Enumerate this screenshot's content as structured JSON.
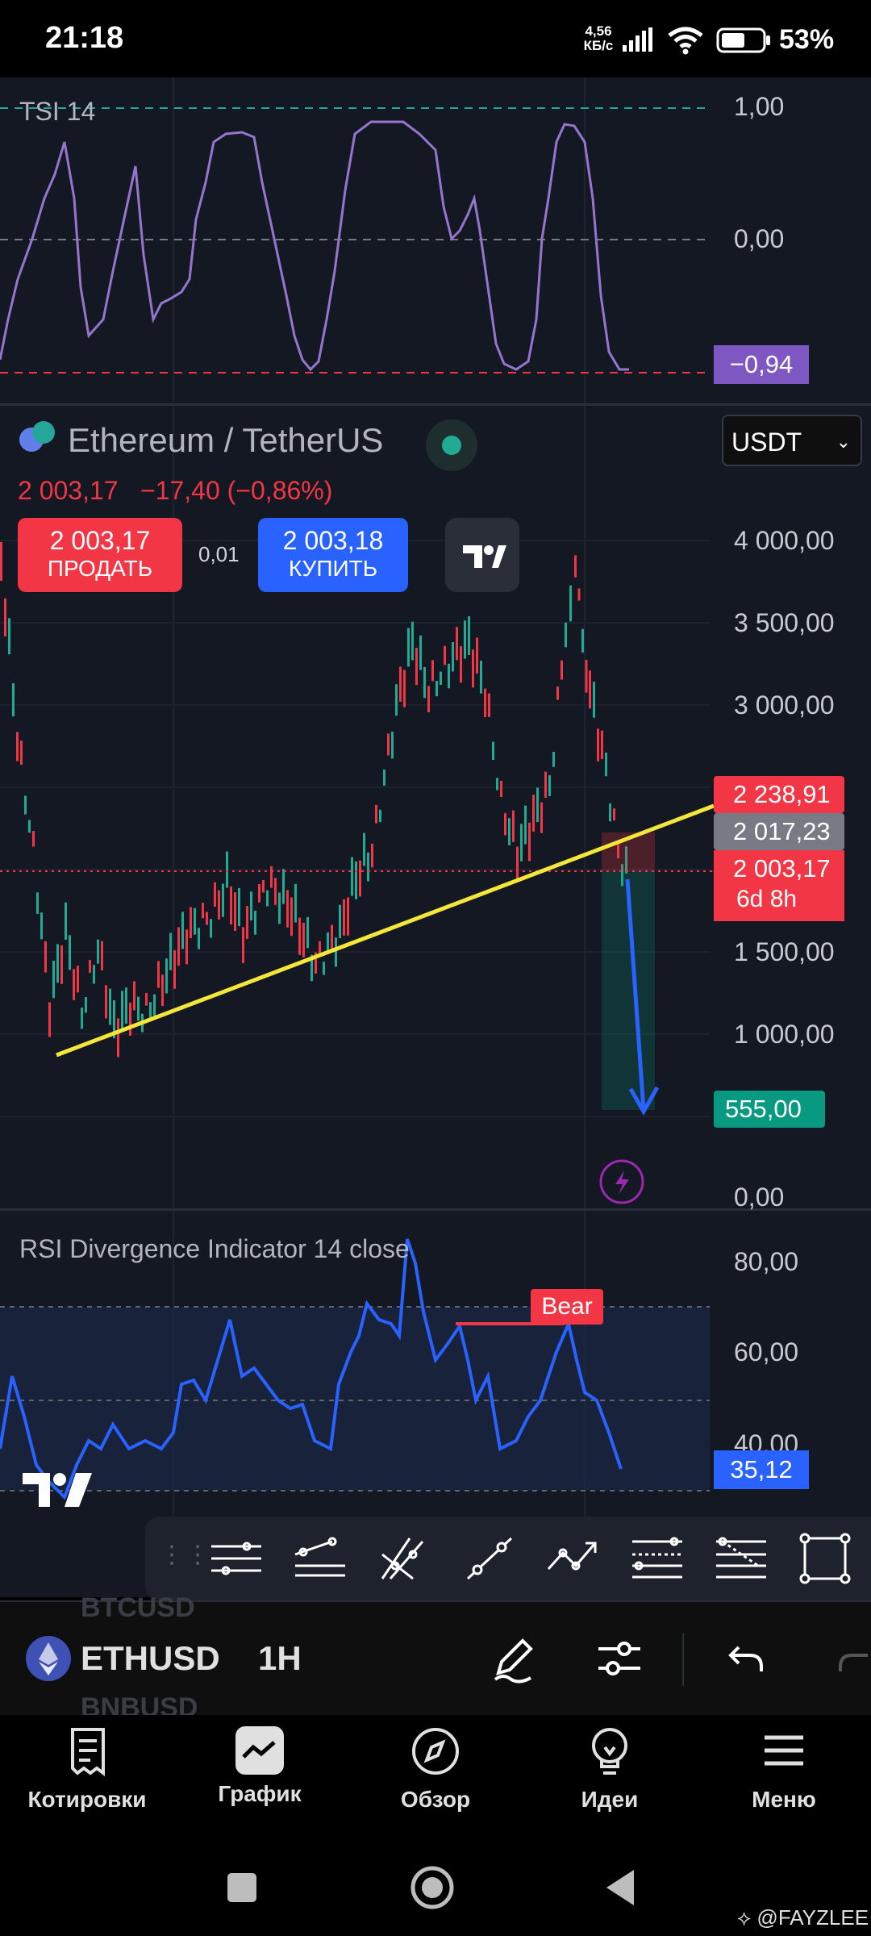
{
  "status_bar": {
    "time": "21:18",
    "net_speed_value": "4,56",
    "net_speed_unit": "КБ/с",
    "battery": "53%"
  },
  "tsi": {
    "title": "TSI 14",
    "axis": [
      "1,00",
      "0,00"
    ],
    "value": "−0,94",
    "value_color": "#7e57c2"
  },
  "symbol": {
    "name": "Ethereum / TetherUS",
    "price_line": "2 003,17",
    "change": "−17,40 (−0,86%)",
    "currency_select": "USDT",
    "sell_price": "2 003,17",
    "sell_label": "ПРОДАТЬ",
    "spread": "0,01",
    "buy_price": "2 003,18",
    "buy_label": "КУПИТЬ"
  },
  "main_axis": [
    "4 000,00",
    "3 500,00",
    "3 000,00",
    "1 500,00",
    "1 000,00",
    "0,00"
  ],
  "price_tags": {
    "target_top": "2 238,91",
    "entry": "2 017,23",
    "last": "2 003,17",
    "countdown": "6d 8h",
    "target_bottom": "555,00"
  },
  "rsi": {
    "title": "RSI Divergence Indicator 14 close",
    "axis": [
      "80,00",
      "60,00",
      "40,00"
    ],
    "value": "35,12",
    "bear_label": "Bear"
  },
  "symbol_bar": {
    "prev_symbol": "BTCUSD",
    "symbol": "ETHUSD",
    "next_symbol": "BNBUSD",
    "interval": "1H"
  },
  "nav": {
    "items": [
      "Котировки",
      "График",
      "Обзор",
      "Идеи",
      "Меню"
    ]
  },
  "watermark": "@FAYZLEE",
  "colors": {
    "sell": "#f23645",
    "buy": "#2962ff",
    "trendline": "#f5e63a",
    "target_green": "#089981",
    "bg": "#141823"
  }
}
